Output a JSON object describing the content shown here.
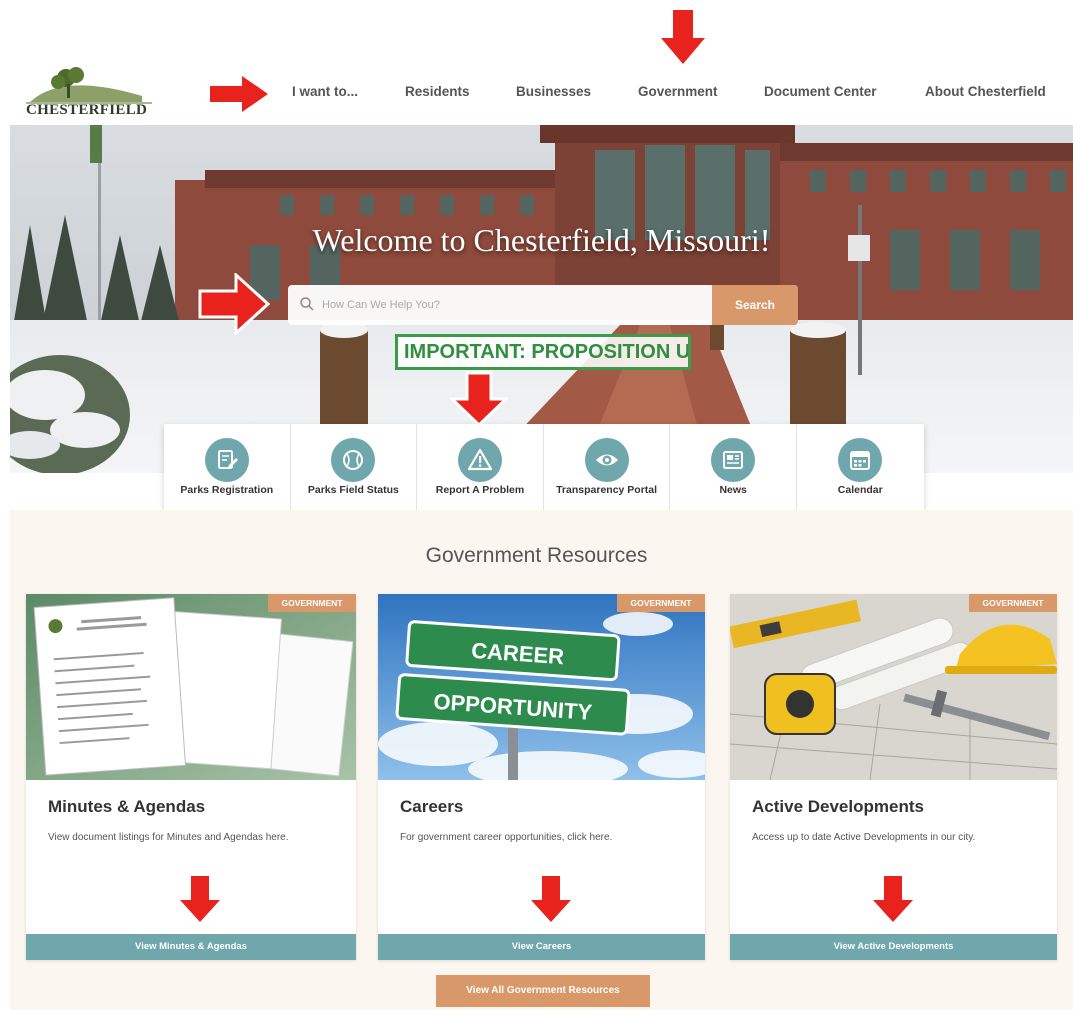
{
  "header": {
    "logo_text": "CHESTERFIELD",
    "nav": [
      "I want to...",
      "Residents",
      "Businesses",
      "Government",
      "Document Center",
      "About Chesterfield"
    ]
  },
  "hero": {
    "title": "Welcome to Chesterfield, Missouri!",
    "search_placeholder": "How Can We Help You?",
    "search_button": "Search",
    "alert": "IMPORTANT: PROPOSITION U"
  },
  "quick_links": [
    {
      "label": "Parks Registration",
      "icon": "registration-icon"
    },
    {
      "label": "Parks Field Status",
      "icon": "baseball-icon"
    },
    {
      "label": "Report A Problem",
      "icon": "warning-icon"
    },
    {
      "label": "Transparency Portal",
      "icon": "eye-icon"
    },
    {
      "label": "News",
      "icon": "newspaper-icon"
    },
    {
      "label": "Calendar",
      "icon": "calendar-icon"
    }
  ],
  "resources": {
    "title": "Government Resources",
    "cards": [
      {
        "tag": "GOVERNMENT",
        "title": "Minutes & Agendas",
        "description": "View document listings for Minutes and Agendas here.",
        "button": "View Minutes & Agendas"
      },
      {
        "tag": "GOVERNMENT",
        "title": "Careers",
        "description": "For government career opportunities, click here.",
        "button": "View Careers",
        "sign_top": "CAREER",
        "sign_bottom": "OPPORTUNITY"
      },
      {
        "tag": "GOVERNMENT",
        "title": "Active Developments",
        "description": "Access up to date Active Developments in our city.",
        "button": "View Active Developments"
      }
    ],
    "view_all": "View All Government Resources"
  },
  "colors": {
    "accent_orange": "#d8986a",
    "accent_teal": "#6fa7ad",
    "annotation_red": "#e8231e",
    "alert_green": "#3c9a4a"
  }
}
